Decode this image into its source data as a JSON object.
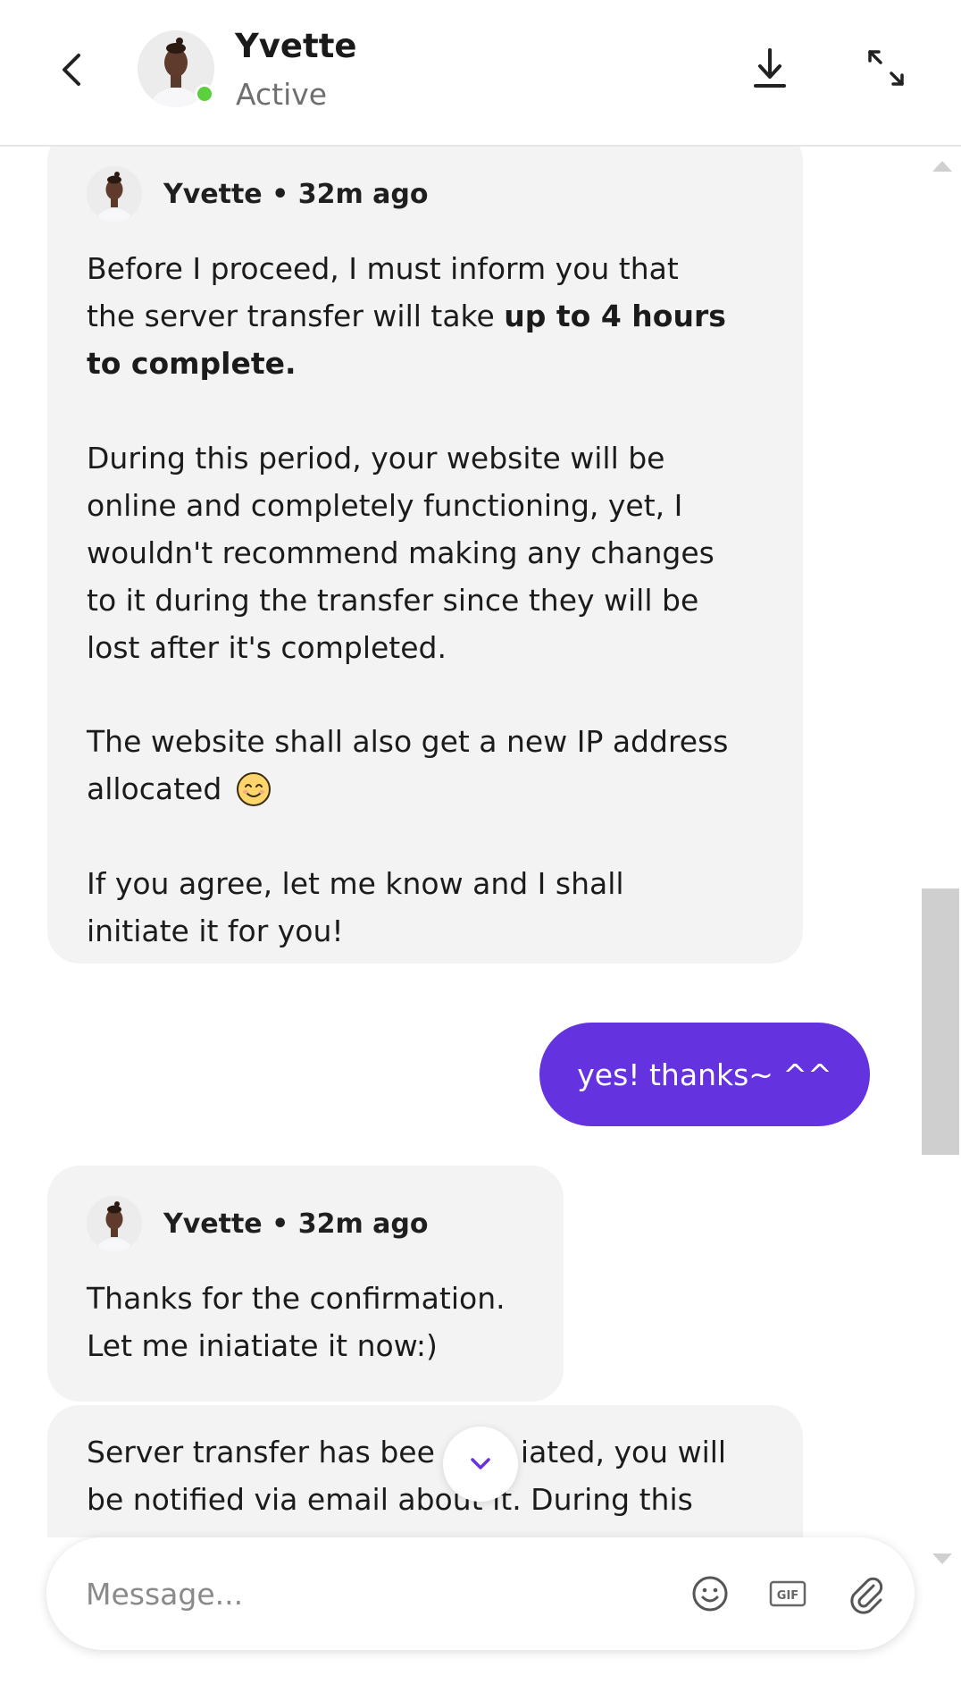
{
  "header": {
    "contact_name": "Yvette",
    "contact_status": "Active",
    "back_icon": "chevron-left-icon",
    "download_icon": "download-icon",
    "expand_icon": "expand-icon"
  },
  "messages": [
    {
      "direction": "incoming",
      "sender": "Yvette",
      "time": "32m ago",
      "meta": "Yvette • 32m ago",
      "lines": [
        "Before I proceed, I must inform you that",
        "the server transfer will take ",
        "up to 4 hours",
        "to complete.",
        "During this period, your website will be",
        "online and completely functioning, yet, I",
        "wouldn't recommend making any changes",
        "to it during the transfer since they will be",
        "lost after it's completed.",
        "The website shall also get a new IP address",
        "allocated",
        "If you agree, let me know and I shall",
        "initiate it for you!"
      ],
      "emoji": "smiling-face-icon"
    },
    {
      "direction": "outgoing",
      "text": "yes! thanks~ ^^"
    },
    {
      "direction": "incoming",
      "sender": "Yvette",
      "time": "32m ago",
      "meta": "Yvette • 32m ago",
      "lines": [
        "Thanks for the confirmation.",
        "Let me iniatiate it now:)"
      ]
    },
    {
      "direction": "incoming",
      "lines": [
        "Server transfer has bee",
        "iated, you will",
        "be notified via email abo",
        "ut it. During this"
      ]
    }
  ],
  "composer": {
    "placeholder": "Message...",
    "value": "",
    "emoji_icon": "emoji-icon",
    "gif_icon": "gif-icon",
    "attach_icon": "paperclip-icon"
  },
  "colors": {
    "accent": "#6532e0",
    "bubble_incoming": "#f3f3f3",
    "status_online": "#5ad13b",
    "text_muted": "#6f6f6f"
  }
}
